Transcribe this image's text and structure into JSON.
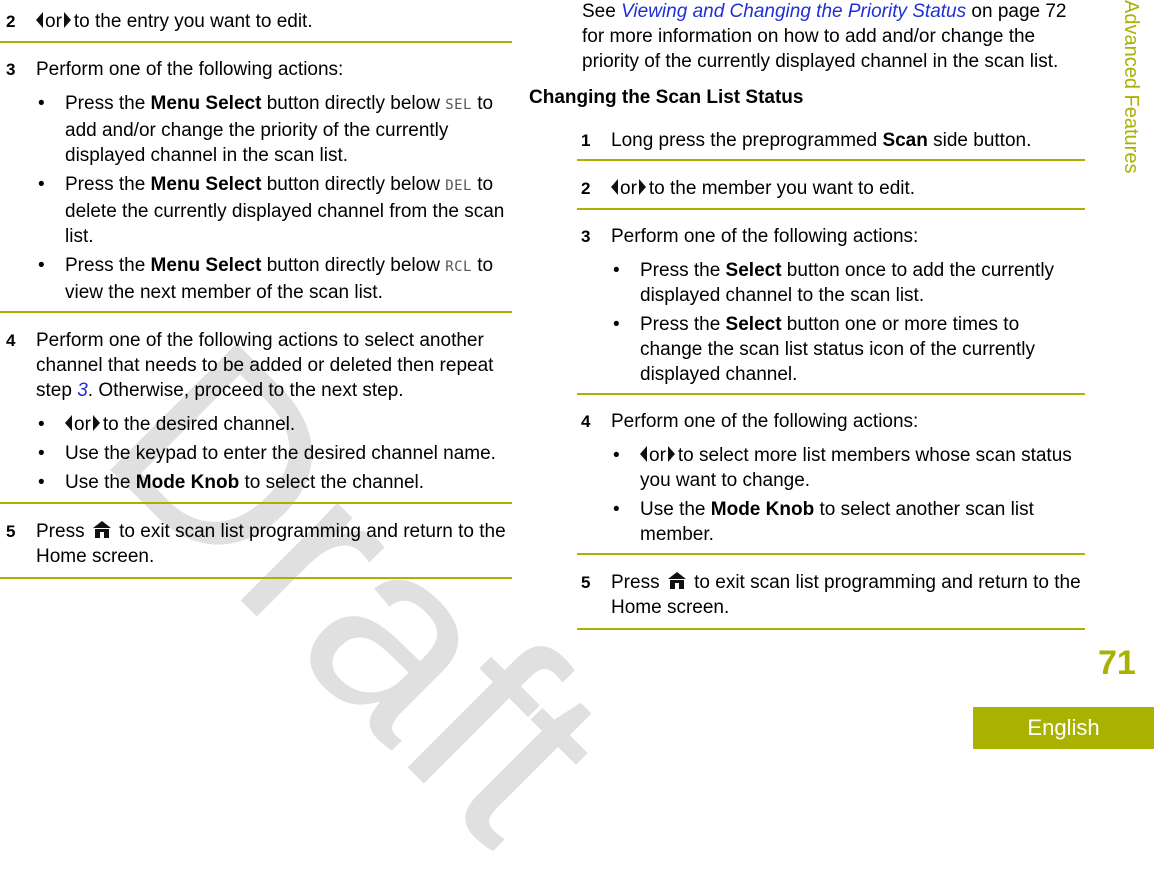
{
  "watermark": "Draft",
  "side_tab": "Advanced Features",
  "page_number": "71",
  "language_tab": "English",
  "colors": {
    "accent": "#a9b200",
    "link": "#1f2fd6"
  },
  "left_column": {
    "steps": [
      {
        "num": "2",
        "arrow_or": "or",
        "text": "to the entry you want to edit."
      },
      {
        "num": "3",
        "text": "Perform one of the following actions:",
        "bullets": [
          {
            "pre": "Press the ",
            "bold": "Menu Select",
            "mid": " button directly below ",
            "lcd": "SEL",
            "post": " to add and/or change the priority of the currently displayed channel in the scan list."
          },
          {
            "pre": "Press the ",
            "bold": "Menu Select",
            "mid": " button directly below ",
            "lcd": "DEL",
            "post": " to delete the currently displayed channel from the scan list."
          },
          {
            "pre": "Press the ",
            "bold": "Menu Select",
            "mid": " button directly below ",
            "lcd": "RCL",
            "post": " to view the next member of the scan list."
          }
        ]
      },
      {
        "num": "4",
        "text_pre": "Perform one of the following actions to select another channel that needs to be added or deleted then repeat step ",
        "link": "3",
        "text_post": ". Otherwise, proceed to the next step.",
        "bullets": [
          {
            "arrow_or": "or",
            "text": "to the desired channel."
          },
          {
            "text": "Use the keypad to enter the desired channel name."
          },
          {
            "pre": "Use the ",
            "bold": "Mode Knob",
            "post": " to select the channel."
          }
        ]
      },
      {
        "num": "5",
        "pre": "Press",
        "post": "to exit scan list programming and return to the Home screen."
      }
    ]
  },
  "right_column": {
    "intro": {
      "pre": "See ",
      "link": "Viewing and Changing the Priority Status",
      "post": " on page 72 for more information on how to add and/or change the priority of the currently displayed channel in the scan list."
    },
    "heading": "Changing the Scan List Status",
    "steps": [
      {
        "num": "1",
        "pre": "Long press the preprogrammed ",
        "bold": "Scan",
        "post": " side button."
      },
      {
        "num": "2",
        "arrow_or": "or",
        "text": "to the member you want to edit."
      },
      {
        "num": "3",
        "text": "Perform one of the following actions:",
        "bullets": [
          {
            "pre": "Press the ",
            "bold": "Select",
            "post": " button once to add the currently displayed channel to the scan list."
          },
          {
            "pre": "Press the ",
            "bold": "Select",
            "post": " button one or more times to change the scan list status icon of the currently displayed channel."
          }
        ]
      },
      {
        "num": "4",
        "text": "Perform one of the following actions:",
        "bullets": [
          {
            "arrow_or": "or",
            "text": "to select more list members whose scan status you want to change."
          },
          {
            "pre": "Use the ",
            "bold": "Mode Knob",
            "post": " to select another scan list member."
          }
        ]
      },
      {
        "num": "5",
        "pre": "Press",
        "post": "to exit scan list programming and return to the Home screen."
      }
    ]
  }
}
